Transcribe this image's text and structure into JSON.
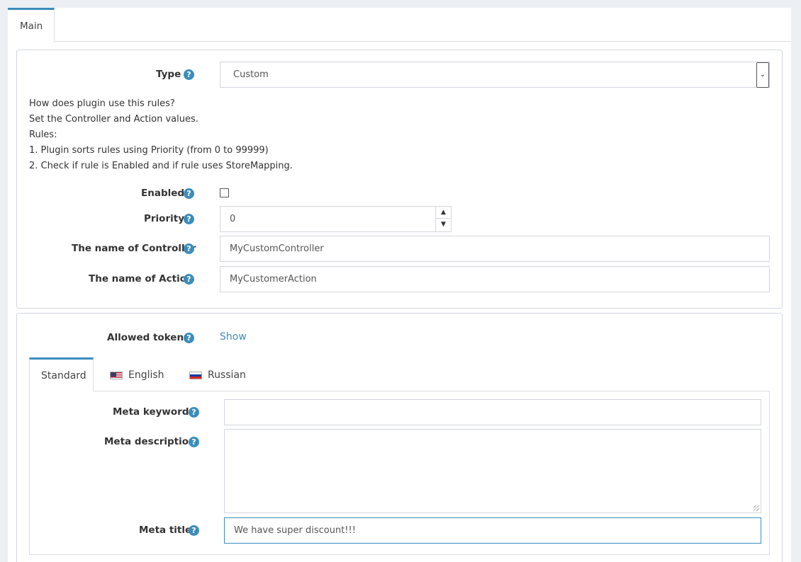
{
  "tabs": {
    "main": "Main"
  },
  "form": {
    "type": {
      "label": "Type",
      "value": "Custom"
    },
    "info_lines": [
      "How does plugin use this rules?",
      "Set the Controller and Action values.",
      "Rules:",
      "1. Plugin sorts rules using Priority (from 0 to 99999)",
      "2. Check if rule is Enabled and if rule uses StoreMapping."
    ],
    "enabled": {
      "label": "Enabled",
      "checked": false
    },
    "priority": {
      "label": "Priority",
      "value": "0"
    },
    "controller": {
      "label": "The name of Controller",
      "value": "MyCustomController"
    },
    "action": {
      "label": "The name of Action",
      "value": "MyCustomerAction"
    }
  },
  "tokens": {
    "label": "Allowed tokens",
    "link": "Show"
  },
  "lang_tabs": [
    "Standard",
    "English",
    "Russian"
  ],
  "meta": {
    "keywords": {
      "label": "Meta keywords",
      "value": ""
    },
    "description": {
      "label": "Meta description",
      "value": ""
    },
    "title": {
      "label": "Meta title",
      "value": "We have super discount!!!"
    }
  },
  "help_glyph": "?",
  "icons": {
    "help": "question-circle-icon",
    "select_arrow": "chevron-down-icon"
  },
  "colors": {
    "accent": "#3c8dbc",
    "page_bg": "#ecf0f5",
    "border": "#d2d6de"
  }
}
